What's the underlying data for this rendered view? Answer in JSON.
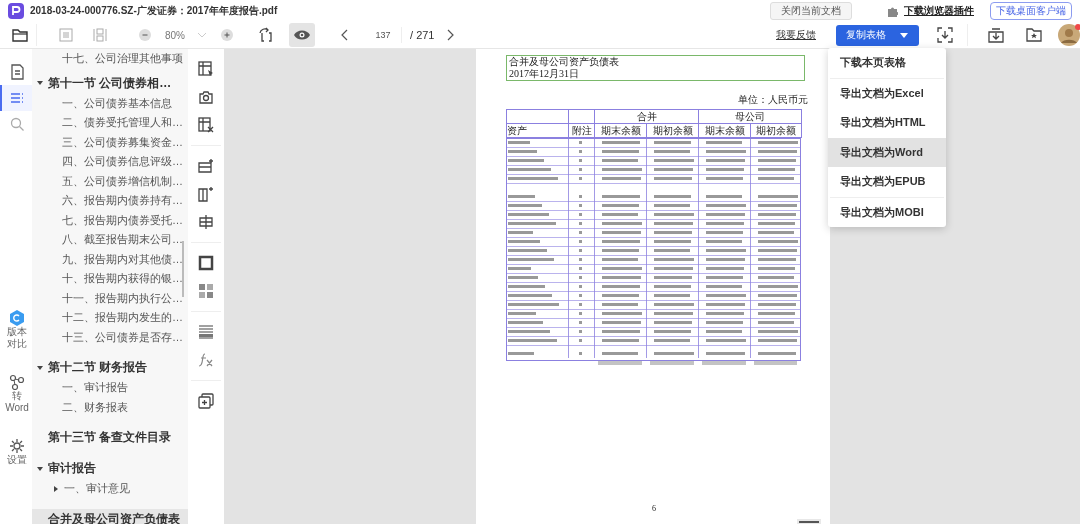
{
  "title_bar": {
    "filename": "2018-03-24-000776.SZ-广发证券：2017年年度报告.pdf",
    "close_button": "关闭当前文档",
    "plugin_link": "下载浏览器插件",
    "client_button": "下载桌面客户端"
  },
  "toolbar": {
    "zoom": "80%",
    "page": "137",
    "total": "/ 271",
    "feedback": "我要反馈",
    "primary_button": "复制表格",
    "eye_on": true
  },
  "rail": [
    {
      "kind": "document",
      "selected": false
    },
    {
      "kind": "outline",
      "selected": true
    },
    {
      "kind": "search",
      "selected": false
    },
    {
      "kind": "compare",
      "label": "版本对比",
      "selected": false
    },
    {
      "kind": "convert",
      "label": "转 Word",
      "selected": false
    },
    {
      "kind": "settings",
      "label": "设置",
      "selected": false
    }
  ],
  "outline": [
    {
      "text": "十七、公司治理其他事项",
      "kind": "orphan",
      "selected": false
    },
    {
      "text": "第十一节 公司债券相…",
      "expanded": true,
      "selected": false,
      "children": [
        {
          "text": "一、公司债券基本信息",
          "selected": false
        },
        {
          "text": "二、债券受托管理人和…",
          "selected": false
        },
        {
          "text": "三、公司债券募集资金…",
          "selected": false
        },
        {
          "text": "四、公司债券信息评级…",
          "selected": false
        },
        {
          "text": "五、公司债券增信机制…",
          "selected": false
        },
        {
          "text": "六、报告期内债券持有…",
          "selected": false
        },
        {
          "text": "七、报告期内债券受托…",
          "selected": false
        },
        {
          "text": "八、截至报告期末公司…",
          "selected": false
        },
        {
          "text": "九、报告期内对其他债…",
          "selected": false
        },
        {
          "text": "十、报告期内获得的银…",
          "selected": false
        },
        {
          "text": "十一、报告期内执行公…",
          "selected": false
        },
        {
          "text": "十二、报告期内发生的…",
          "selected": false
        },
        {
          "text": "十三、公司债券是否存…",
          "selected": false
        }
      ]
    },
    {
      "text": "第十二节 财务报告",
      "expanded": true,
      "selected": false,
      "children": [
        {
          "text": "一、审计报告",
          "selected": false
        },
        {
          "text": "二、财务报表",
          "selected": false
        }
      ]
    },
    {
      "text": "第十三节 备查文件目录",
      "selected": false
    },
    {
      "text": "审计报告",
      "expanded": true,
      "selected": false,
      "children": [
        {
          "text": "一、审计意见",
          "expanded": false,
          "selected": false
        }
      ]
    },
    {
      "text": "合并及母公司资产负债表",
      "selected": true
    }
  ],
  "document": {
    "title": "合并及母公司资产负债表",
    "date": "2017年12月31日",
    "unit": "单位：人民币元",
    "columns": [
      "资产",
      "附注"
    ],
    "groups": [
      {
        "label": "合并",
        "columns": [
          "期末余额",
          "期初余额"
        ]
      },
      {
        "label": "母公司",
        "columns": [
          "期末余额",
          "期初余额"
        ]
      }
    ],
    "page_number": "6"
  },
  "export_menu": [
    {
      "label": "下载本页表格",
      "selected": false
    },
    {
      "label": "导出文档为Excel",
      "selected": false
    },
    {
      "label": "导出文档为HTML",
      "selected": false
    },
    {
      "label": "导出文档为Word",
      "selected": true
    },
    {
      "label": "导出文档为EPUB",
      "selected": false
    },
    {
      "label": "导出文档为MOBI",
      "selected": false
    }
  ]
}
